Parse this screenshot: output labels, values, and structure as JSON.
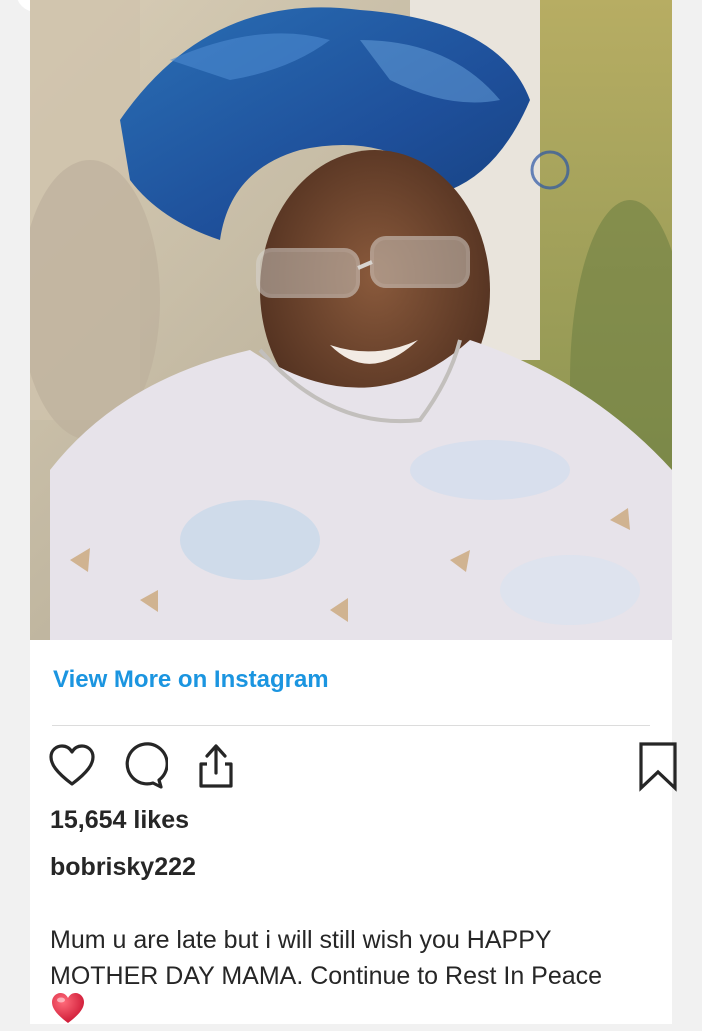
{
  "post": {
    "view_more_label": "View More on Instagram",
    "likes": "15,654 likes",
    "username": "bobrisky222",
    "caption_line1": "Mum u are late but i will still wish you HAPPY",
    "caption_line2": "MOTHER DAY MAMA. Continue to Rest In Peace",
    "caption_emoji": "heart-emoji",
    "link_color": "#1b95e0"
  },
  "actions": {
    "icons": [
      "heart-icon",
      "comment-icon",
      "share-icon",
      "bookmark-icon"
    ]
  }
}
